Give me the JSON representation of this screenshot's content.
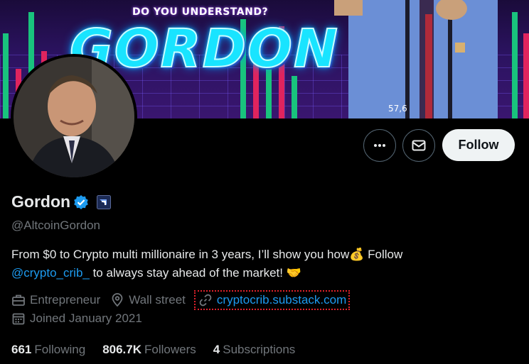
{
  "banner": {
    "tagline": "DO YOU UNDERSTAND?",
    "title": "GORDON",
    "ticker": "57,6"
  },
  "actions": {
    "follow_label": "Follow"
  },
  "profile": {
    "display_name": "Gordon",
    "handle": "@AltcoinGordon",
    "bio_part1": "From $0 to Crypto multi millionaire in 3 years, I’ll show you how",
    "bio_emoji1": "💰",
    "bio_part2": " Follow",
    "bio_mention": "@crypto_crib_",
    "bio_part3": " to always stay ahead of the market! ",
    "bio_emoji2": "🤝"
  },
  "meta": {
    "profession": "Entrepreneur",
    "location": "Wall street",
    "website": "cryptocrib.substack.com",
    "joined": "Joined January 2021"
  },
  "stats": {
    "following_count": "661",
    "following_label": "Following",
    "followers_count": "806.7K",
    "followers_label": "Followers",
    "subscriptions_count": "4",
    "subscriptions_label": "Subscriptions"
  },
  "colors": {
    "accent": "#1d9bf0",
    "muted": "#71767b",
    "text": "#e7e9ea",
    "background": "#000000"
  }
}
